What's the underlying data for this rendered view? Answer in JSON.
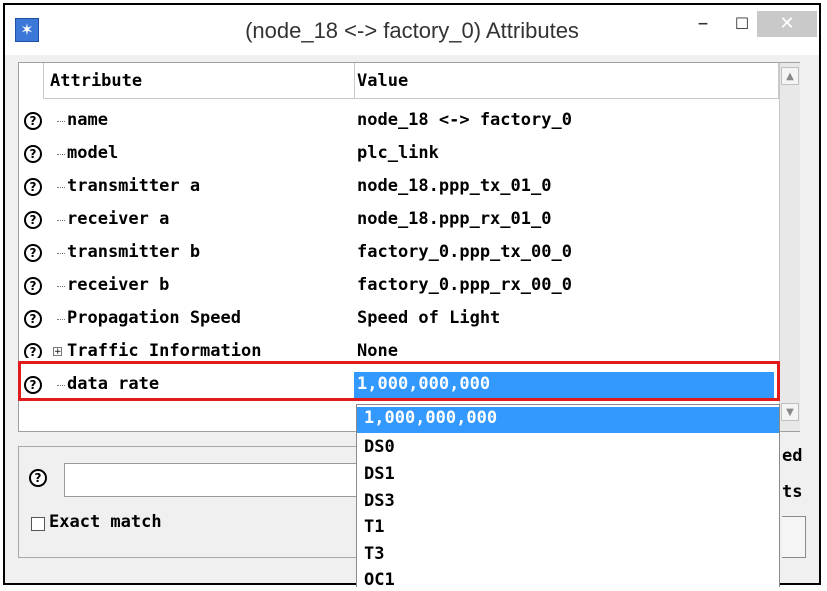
{
  "window": {
    "title": "(node_18 <-> factory_0) Attributes",
    "app_icon_glyph": "✶",
    "minimize_glyph": "–",
    "maximize_glyph": "☐",
    "close_glyph": "✕"
  },
  "table": {
    "headers": {
      "attribute": "Attribute",
      "value": "Value"
    },
    "rows": [
      {
        "name": "name",
        "value": "node_18 <-> factory_0"
      },
      {
        "name": "model",
        "value": "plc_link"
      },
      {
        "name": "transmitter a",
        "value": "node_18.ppp_tx_01_0"
      },
      {
        "name": "receiver a",
        "value": "node_18.ppp_rx_01_0"
      },
      {
        "name": "transmitter b",
        "value": "factory_0.ppp_tx_00_0"
      },
      {
        "name": "receiver b",
        "value": "factory_0.ppp_rx_00_0"
      },
      {
        "name": "Propagation Speed",
        "value": "Speed of Light"
      },
      {
        "name": "Traffic Information",
        "value": "None"
      },
      {
        "name": "data rate",
        "value": "1,000,000,000"
      }
    ],
    "help_glyph": "?",
    "expand_glyph": "+"
  },
  "dropdown": {
    "options": [
      "1,000,000,000",
      "DS0",
      "DS1",
      "DS3",
      "T1",
      "T3",
      "OC1"
    ],
    "selected_index": 0
  },
  "search": {
    "value": "",
    "exact_match_label": "Exact match",
    "exact_match_checked": false
  },
  "side_labels": [
    "ed",
    "ts"
  ],
  "colors": {
    "selection": "#3399ff",
    "highlight_border": "#e11b1b"
  }
}
